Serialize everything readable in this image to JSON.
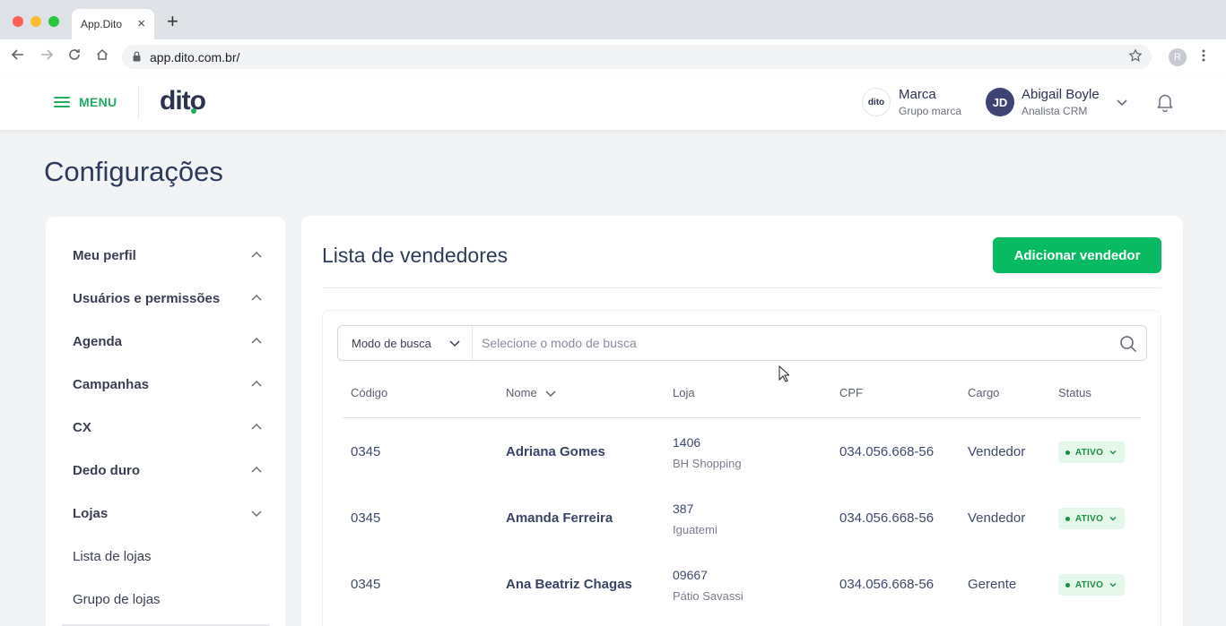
{
  "browser": {
    "tab_title": "App.Dito",
    "tab_close": "×",
    "new_tab": "+",
    "url": "app.dito.com.br/",
    "profile_initial": "R",
    "traffic_lights": [
      "#ff5f57",
      "#febc2e",
      "#28c840"
    ]
  },
  "header": {
    "menu_label": "MENU",
    "logo_text": "dito",
    "brand": {
      "logo_text": "dito",
      "name": "Marca",
      "subtitle": "Grupo marca"
    },
    "user": {
      "initials": "JD",
      "name": "Abigail Boyle",
      "role": "Analista CRM"
    },
    "accent_color": "#1fae62"
  },
  "page": {
    "title": "Configurações"
  },
  "sidebar": {
    "items": [
      {
        "label": "Meu perfil",
        "chevron": "up"
      },
      {
        "label": "Usuários e permissões",
        "chevron": "up"
      },
      {
        "label": "Agenda",
        "chevron": "up"
      },
      {
        "label": "Campanhas",
        "chevron": "up"
      },
      {
        "label": "CX",
        "chevron": "up"
      },
      {
        "label": "Dedo duro",
        "chevron": "up"
      },
      {
        "label": "Lojas",
        "chevron": "down"
      },
      {
        "label": "Lista de lojas",
        "chevron": "none"
      },
      {
        "label": "Grupo de lojas",
        "chevron": "none"
      }
    ]
  },
  "main": {
    "title": "Lista de vendedores",
    "add_button": "Adicionar vendedor",
    "button_color": "#08bb63",
    "search": {
      "mode_label": "Modo de busca",
      "placeholder": "Selecione o modo de busca"
    },
    "table": {
      "columns": [
        "Código",
        "Nome",
        "Loja",
        "CPF",
        "Cargo",
        "Status"
      ],
      "rows": [
        {
          "code": "0345",
          "name": "Adriana Gomes",
          "store_number": "1406",
          "store_name": "BH Shopping",
          "cpf": "034.056.668-56",
          "role": "Vendedor",
          "status": "ATIVO"
        },
        {
          "code": "0345",
          "name": "Amanda Ferreira",
          "store_number": "387",
          "store_name": "Iguatemi",
          "cpf": "034.056.668-56",
          "role": "Vendedor",
          "status": "ATIVO"
        },
        {
          "code": "0345",
          "name": "Ana Beatriz Chagas",
          "store_number": "09667",
          "store_name": "Pátio Savassi",
          "cpf": "034.056.668-56",
          "role": "Gerente",
          "status": "ATIVO"
        }
      ]
    }
  }
}
